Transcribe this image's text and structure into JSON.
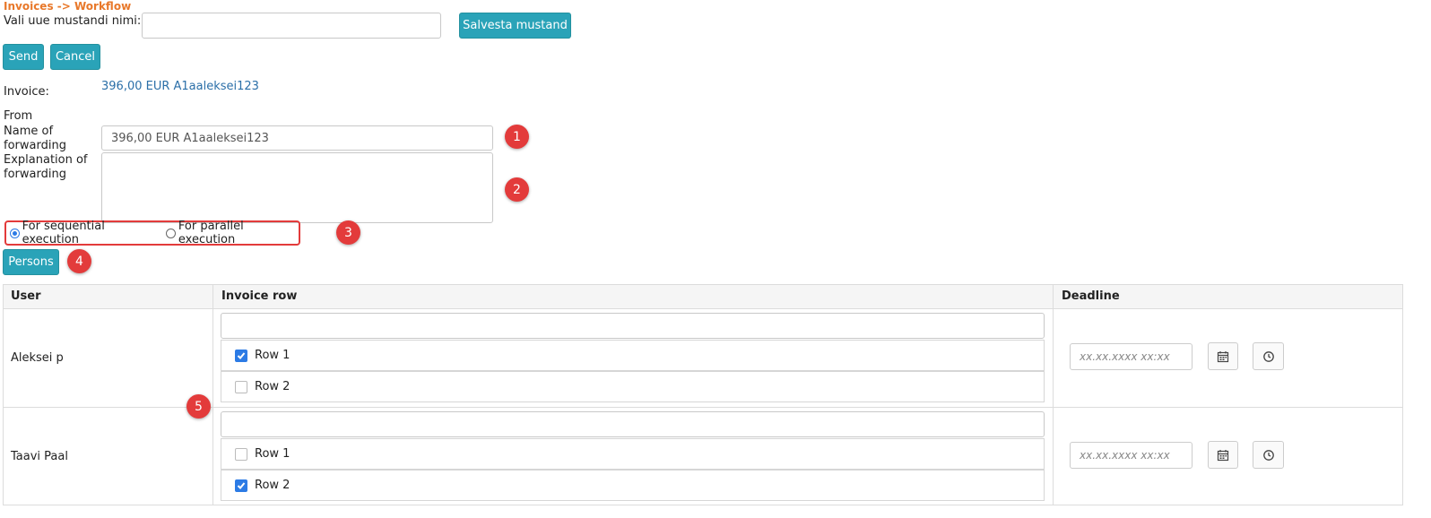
{
  "breadcrumb": "Invoices -> Workflow",
  "template": {
    "label": "Vali uue mustandi nimi:",
    "value": "",
    "save_label": "Salvesta mustand"
  },
  "actions": {
    "send": "Send",
    "cancel": "Cancel"
  },
  "invoice": {
    "label": "Invoice:",
    "value": "396,00 EUR A1aaleksei123"
  },
  "from_label": "From",
  "forward_name": {
    "label_1": "Name of",
    "label_2": "forwarding",
    "value": "396,00 EUR A1aaleksei123"
  },
  "forward_expl": {
    "label_1": "Explanation of",
    "label_2": "forwarding",
    "value": ""
  },
  "execution": {
    "sequential": "For sequential execution",
    "parallel": "For parallel execution",
    "selected": "sequential"
  },
  "persons_label": "Persons",
  "badges": [
    "1",
    "2",
    "3",
    "4",
    "5"
  ],
  "table": {
    "headers": {
      "user": "User",
      "rows": "Invoice row",
      "deadline": "Deadline"
    },
    "rows": [
      {
        "user": "Aleksei p",
        "filter": "",
        "items": [
          {
            "label": "Row 1",
            "checked": true
          },
          {
            "label": "Row 2",
            "checked": false
          }
        ],
        "deadline_placeholder": "xx.xx.xxxx xx:xx"
      },
      {
        "user": "Taavi Paal",
        "filter": "",
        "items": [
          {
            "label": "Row 1",
            "checked": false
          },
          {
            "label": "Row 2",
            "checked": true
          }
        ],
        "deadline_placeholder": "xx.xx.xxxx xx:xx"
      }
    ]
  },
  "colors": {
    "accent": "#2aa3b8",
    "breadcrumb": "#e8782a",
    "badge": "#e33b3b",
    "link": "#2b6fa8",
    "check": "#2c7be5"
  }
}
